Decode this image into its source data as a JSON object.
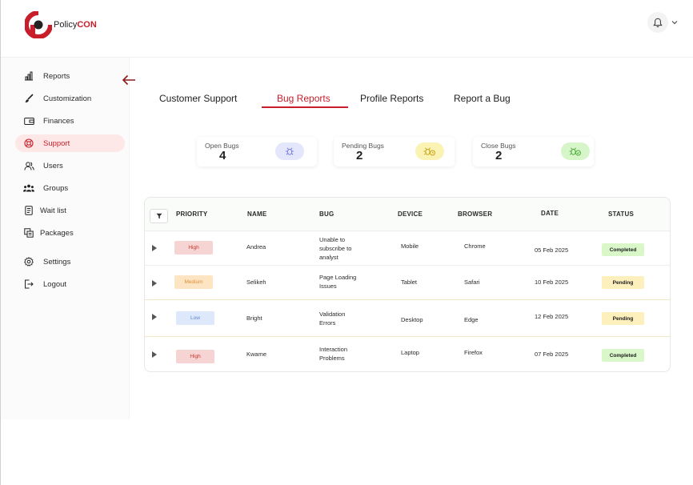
{
  "brand": {
    "name_part1": "Policy",
    "name_part2": "CON"
  },
  "sidebar": {
    "items": [
      {
        "label": "Reports",
        "icon": "bar-chart-icon"
      },
      {
        "label": "Customization",
        "icon": "brush-icon"
      },
      {
        "label": "Finances",
        "icon": "wallet-icon"
      },
      {
        "label": "Support",
        "icon": "lifebuoy-icon",
        "active": true
      },
      {
        "label": "Users",
        "icon": "users-icon"
      },
      {
        "label": "Groups",
        "icon": "groups-icon"
      },
      {
        "label": "Wait list",
        "icon": "list-icon"
      },
      {
        "label": "Packages",
        "icon": "package-icon"
      },
      {
        "label": "Settings",
        "icon": "gear-icon"
      },
      {
        "label": "Logout",
        "icon": "logout-icon"
      }
    ]
  },
  "tabs": [
    {
      "label": "Customer Support"
    },
    {
      "label": "Bug Reports",
      "active": true
    },
    {
      "label": "Profile Reports"
    },
    {
      "label": "Report a Bug"
    }
  ],
  "stats": [
    {
      "label": "Open Bugs",
      "value": "4",
      "icon": "bug-icon",
      "color": "#e4e6fb"
    },
    {
      "label": "Pending Bugs",
      "value": "2",
      "icon": "bug-clock-icon",
      "color": "#fbf3b4"
    },
    {
      "label": "Close Bugs",
      "value": "2",
      "icon": "bug-check-icon",
      "color": "#d6f6c9"
    }
  ],
  "table": {
    "headers": [
      "PRIORITY",
      "NAME",
      "BUG",
      "DEVICE",
      "BROWSER",
      "DATE",
      "STATUS"
    ],
    "rows": [
      {
        "priority": "High",
        "name": "Andrea",
        "bug": [
          "Unable to",
          "subscribe to",
          "analyst"
        ],
        "device": "Mobile",
        "browser": "Chrome",
        "date": "05 Feb 2025",
        "status": "Completed"
      },
      {
        "priority": "Medium",
        "name": "Selikeh",
        "bug": [
          "Page Loading",
          "Issues"
        ],
        "device": "Tablet",
        "browser": "Safari",
        "date": "10 Feb 2025",
        "status": "Pending"
      },
      {
        "priority": "Low",
        "name": "Bright",
        "bug": [
          "Validation",
          "Errors"
        ],
        "device": "Desktop",
        "browser": "Edge",
        "date": "12 Feb 2025",
        "status": "Pending"
      },
      {
        "priority": "High",
        "name": "Kwame",
        "bug": [
          "Interaction",
          "Problems"
        ],
        "device": "Laptop",
        "browser": "Firefox",
        "date": "07 Feb 2025",
        "status": "Completed"
      }
    ]
  },
  "colors": {
    "accent": "#c81e2b",
    "active_nav_bg": "#fde7e7"
  }
}
